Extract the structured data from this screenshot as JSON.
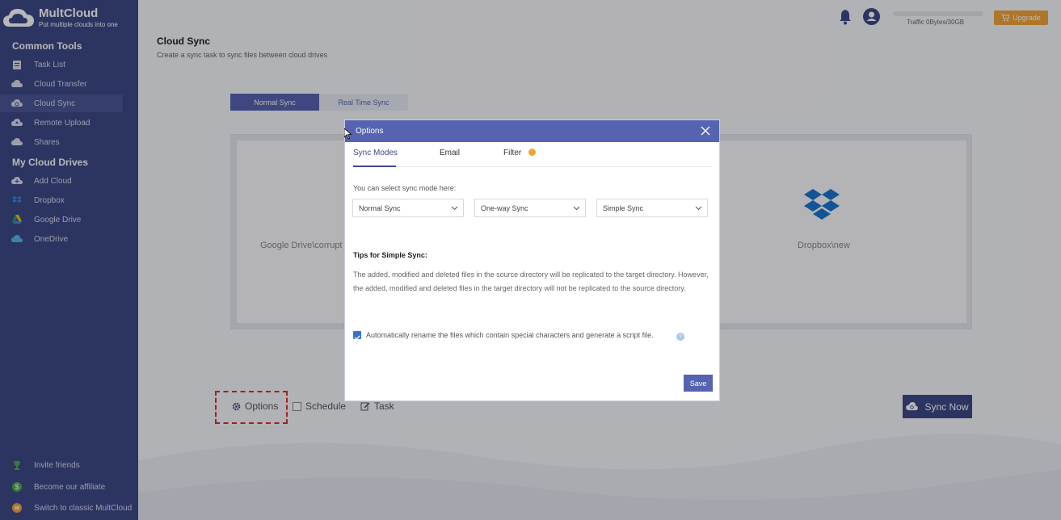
{
  "brand": {
    "name": "MultCloud",
    "tagline": "Put multiple clouds into one"
  },
  "sidebar": {
    "common_tools_heading": "Common Tools",
    "common_tools": [
      {
        "label": "Task List",
        "icon": "clipboard-icon"
      },
      {
        "label": "Cloud Transfer",
        "icon": "cloud-transfer-icon"
      },
      {
        "label": "Cloud Sync",
        "icon": "cloud-sync-icon",
        "active": true
      },
      {
        "label": "Remote Upload",
        "icon": "cloud-upload-icon"
      },
      {
        "label": "Shares",
        "icon": "share-cloud-icon"
      }
    ],
    "my_drives_heading": "My Cloud Drives",
    "my_drives": [
      {
        "label": "Add Cloud",
        "icon": "add-cloud-icon"
      },
      {
        "label": "Dropbox",
        "icon": "dropbox-icon"
      },
      {
        "label": "Google Drive",
        "icon": "google-drive-icon"
      },
      {
        "label": "OneDrive",
        "icon": "onedrive-icon"
      }
    ],
    "footer": [
      {
        "label": "Invite friends",
        "icon": "trophy-icon"
      },
      {
        "label": "Become our affiliate",
        "icon": "dollar-icon"
      },
      {
        "label": "Switch to classic MultCloud",
        "icon": "switch-icon"
      }
    ]
  },
  "header": {
    "traffic": "Traffic 0Bytes/30GB",
    "traffic_used_fraction": 0,
    "upgrade_label": "Upgrade"
  },
  "page": {
    "title": "Cloud Sync",
    "subtitle": "Create a sync task to sync files between cloud drives",
    "tabs": [
      "Normal Sync",
      "Real Time Sync"
    ],
    "source": "Google Drive\\corrupt",
    "target": "Dropbox\\new"
  },
  "bottom": {
    "options_label": "Options",
    "schedule_label": "Schedule",
    "task_label": "Task",
    "sync_now_label": "Sync Now"
  },
  "modal": {
    "title": "Options",
    "tabs": [
      "Sync Modes",
      "Email",
      "Filter"
    ],
    "mode_prompt": "You can select sync mode here:",
    "selects": [
      "Normal Sync",
      "One-way Sync",
      "Simple Sync"
    ],
    "tips_title": "Tips for Simple Sync:",
    "tips_text": "The added, modified and deleted files in the source directory will be replicated to the target directory. However, the added, modified and deleted files in the target directory will not be replicated to the source directory.",
    "rename_checkbox_label": "Automatically rename the files which contain special characters and generate a script file.",
    "rename_checked": true,
    "save_label": "Save"
  },
  "colors": {
    "sidebar": "#3e4988",
    "accent": "#5663b0",
    "upgrade": "#f1a43a",
    "highlight": "#e52c2c"
  }
}
